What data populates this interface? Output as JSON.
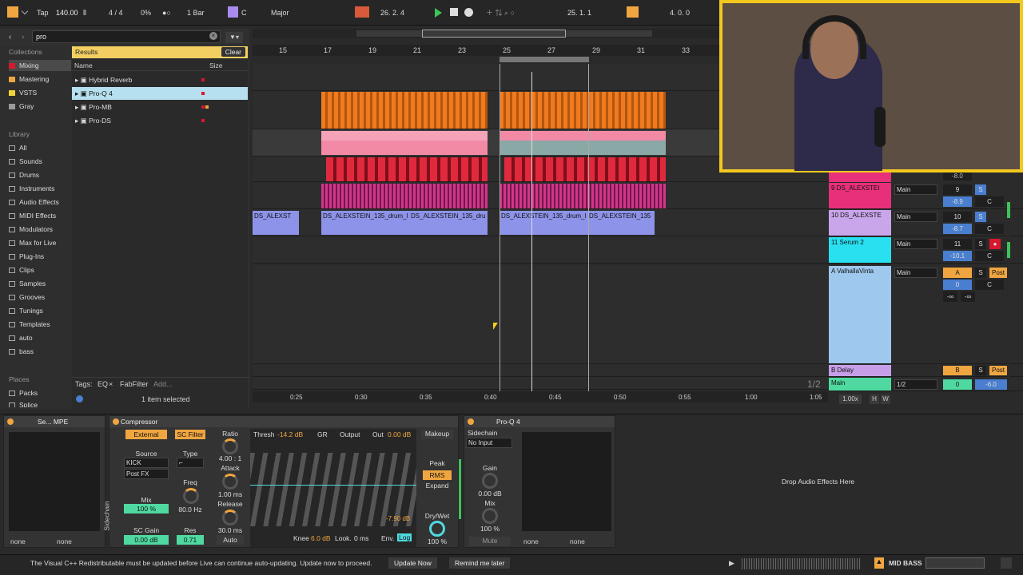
{
  "transport": {
    "tap": "Tap",
    "tempo": "140.00",
    "meter": "4 / 4",
    "swing": "0%",
    "quant": "1 Bar",
    "key": "C",
    "scale": "Major",
    "position": "26.  2.  4",
    "loop_start": "25.  1.  1",
    "loop_len": "4.  0.  0"
  },
  "browser": {
    "search": "pro",
    "collections_label": "Collections",
    "collections": [
      {
        "label": "Mixing",
        "color": "#d9182c"
      },
      {
        "label": "Mastering",
        "color": "#f0a640"
      },
      {
        "label": "VSTS",
        "color": "#f3d33a"
      },
      {
        "label": "Gray",
        "color": "#999999"
      }
    ],
    "library_label": "Library",
    "library": [
      "All",
      "Sounds",
      "Drums",
      "Instruments",
      "Audio Effects",
      "MIDI Effects",
      "Modulators",
      "Max for Live",
      "Plug-Ins",
      "Clips",
      "Samples",
      "Grooves",
      "Tunings",
      "Templates",
      "auto",
      "bass"
    ],
    "places_label": "Places",
    "places": [
      "Packs",
      "Splice"
    ],
    "results_label": "Results",
    "clear": "Clear",
    "col_name": "Name",
    "col_size": "Size",
    "results": [
      {
        "name": "Hybrid Reverb"
      },
      {
        "name": "Pro-Q 4"
      },
      {
        "name": "Pro-MB"
      },
      {
        "name": "Pro-DS"
      }
    ],
    "tags_label": "Tags:",
    "tags": [
      "EQ",
      "FabFilter",
      "Add..."
    ],
    "selected": "1 item selected"
  },
  "ruler": {
    "bars": [
      "15",
      "17",
      "19",
      "21",
      "23",
      "25",
      "27",
      "29",
      "31",
      "33"
    ],
    "times": [
      "0:25",
      "0:30",
      "0:35",
      "0:40",
      "0:45",
      "0:50",
      "0:55",
      "1:00",
      "1:05"
    ]
  },
  "clips": {
    "c1": "DS_ALEXST",
    "c2": "DS_ALEXSTEIN_135_drum_l",
    "c3": "DS_ALEXSTEIN_135_dru",
    "c4": "DS_ALEXSTEIN_135_drum_l",
    "c5": "DS_ALEXSTEIN_135"
  },
  "mixer": [
    {
      "name": "9 DS_ALEXSTEI",
      "out": "Main",
      "num": "9",
      "vol": "-8.9",
      "pan": "C",
      "color": "#e8307a"
    },
    {
      "name": "10 DS_ALEXSTE",
      "out": "Main",
      "num": "10",
      "vol": "-8.7",
      "pan": "C",
      "color": "#c9a5ea"
    },
    {
      "name": "11 Serum 2",
      "out": "Main",
      "num": "11",
      "vol": "-10.1",
      "pan": "C",
      "color": "#28e0f0"
    },
    {
      "name": "A ValhallaVinta",
      "out": "Main",
      "num": "A",
      "vol": "0",
      "pan": "C",
      "color": "#9fc8ee",
      "sendA": "-∞",
      "sendB": "-∞",
      "post": "Post"
    },
    {
      "name": "B Delay",
      "out": "",
      "num": "B",
      "vol": "",
      "pan": "",
      "color": "#c79ee8",
      "post": "Post"
    },
    {
      "name": "Main",
      "out": "1/2",
      "num": "0",
      "vol": "-6.0",
      "pan": "",
      "color": "#4fd9a0"
    }
  ],
  "mixer_extra": {
    "top_vol": "-8.0",
    "split": "1/2",
    "zoom": "1.00x",
    "h": "H",
    "w": "W"
  },
  "devices": {
    "mpe_title": "Se... MPE",
    "mpe_none1": "none",
    "mpe_none2": "none",
    "comp": {
      "title": "Compressor",
      "external": "External",
      "scfilter": "SC Filter",
      "source_label": "Source",
      "source": "KICK",
      "postfx": "Post FX",
      "type_label": "Type",
      "mix_label": "Mix",
      "mix": "100 %",
      "freq_label": "Freq",
      "freq": "80.0 Hz",
      "scgain_label": "SC Gain",
      "scgain": "0.00 dB",
      "res_label": "Res",
      "res": "0.71",
      "ratio_label": "Ratio",
      "ratio": "4.00 : 1",
      "attack_label": "Attack",
      "attack": "1.00 ms",
      "release_label": "Release",
      "release": "30.0 ms",
      "auto": "Auto",
      "thresh_label": "Thresh",
      "thresh": "-14.2 dB",
      "gr": "GR",
      "output": "Output",
      "out_label": "Out",
      "out": "0.00 dB",
      "makeup": "Makeup",
      "peak": "Peak",
      "rms": "RMS",
      "expand": "Expand",
      "drywet_label": "Dry/Wet",
      "drywet": "100 %",
      "knee_label": "Knee",
      "knee": "6.0 dB",
      "look_label": "Look.",
      "look": "0 ms",
      "env_label": "Env.",
      "env": "Log",
      "gr_val": "-7.90 dB",
      "sidechain": "Sidechain"
    },
    "proq": {
      "title": "Pro-Q 4",
      "sidechain": "Sidechain",
      "noinput": "No Input",
      "gain_label": "Gain",
      "gain": "0.00 dB",
      "mix_label": "Mix",
      "mix": "100 %",
      "mute": "Mute",
      "none1": "none",
      "none2": "none"
    },
    "drop": "Drop Audio Effects Here"
  },
  "status": {
    "message": "The Visual C++ Redistributable must be updated before Live can continue auto-updating. Update now to proceed.",
    "update": "Update Now",
    "remind": "Remind me later",
    "track": "MID BASS"
  }
}
